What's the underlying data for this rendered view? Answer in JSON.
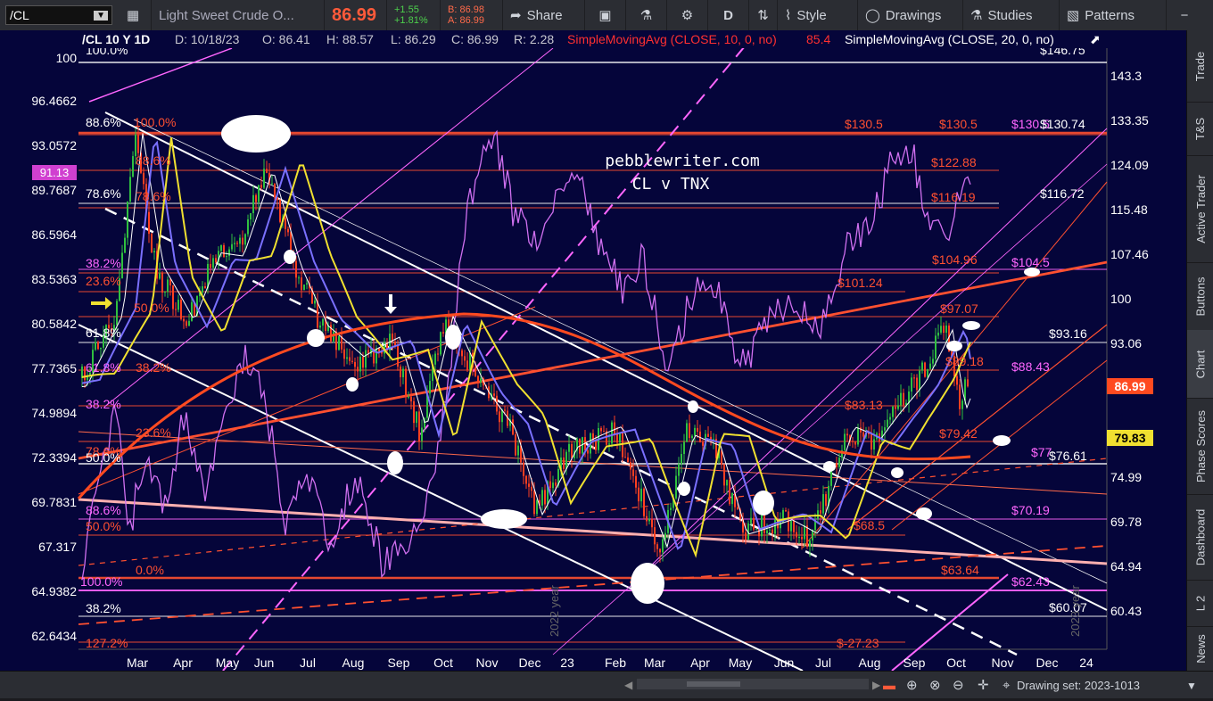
{
  "toolbar": {
    "symbol": "/CL",
    "description": "Light Sweet Crude O...",
    "last": "86.99",
    "change": "+1.55",
    "change_pct": "+1.81%",
    "bid": "B: 86.98",
    "ask": "A: 86.99",
    "share": "Share",
    "period": "D",
    "style": "Style",
    "drawings": "Drawings",
    "studies": "Studies",
    "patterns": "Patterns"
  },
  "header": {
    "title": "/CL 10 Y 1D",
    "date": "D: 10/18/23",
    "open": "O: 86.41",
    "high": "H: 88.57",
    "low": "L: 86.29",
    "close": "C: 86.99",
    "range": "R: 2.28",
    "sma10": "SimpleMovingAvg (CLOSE, 10, 0, no)",
    "sma10_value": "85.4",
    "sma20": "SimpleMovingAvg (CLOSE, 20, 0, no)"
  },
  "watermark": {
    "line1": "pebblewriter.com",
    "line2": "CL v TNX"
  },
  "left_axis": [
    "100",
    "96.4662",
    "93.0572",
    "89.7687",
    "86.5964",
    "83.5363",
    "80.5842",
    "77.7365",
    "74.9894",
    "72.3394",
    "69.7831",
    "67.317",
    "64.9382",
    "62.6434"
  ],
  "right_axis": [
    "143.3",
    "133.35",
    "124.09",
    "115.48",
    "107.46",
    "100",
    "93.06",
    "86.6",
    "80.58",
    "74.99",
    "69.78",
    "64.94",
    "60.43"
  ],
  "price_tags": {
    "last": "86.99",
    "sma": "79.83",
    "tnx": "91.13"
  },
  "x_axis": [
    "Mar",
    "Apr",
    "May",
    "Jun",
    "Jul",
    "Aug",
    "Sep",
    "Oct",
    "Nov",
    "Dec",
    "23",
    "Feb",
    "Mar",
    "Apr",
    "May",
    "Jun",
    "Jul",
    "Aug",
    "Sep",
    "Oct",
    "Nov",
    "Dec",
    "24"
  ],
  "year_markers": [
    "2022 year",
    "2023 year"
  ],
  "fib_labels_left": [
    {
      "text": "100.0%",
      "color": "#ffffff"
    },
    {
      "text": "88.6%",
      "color": "#ffffff"
    },
    {
      "text": "100.0%",
      "color": "#ff5030"
    },
    {
      "text": "88.6%",
      "color": "#ff5030"
    },
    {
      "text": "78.6%",
      "color": "#ffffff"
    },
    {
      "text": "78.6%",
      "color": "#ff5030"
    },
    {
      "text": "38.2%",
      "color": "#ff66ff"
    },
    {
      "text": "23.6%",
      "color": "#ff5030"
    },
    {
      "text": "50.0%",
      "color": "#ff5030"
    },
    {
      "text": "61.8%",
      "color": "#ffffff"
    },
    {
      "text": "61.8%",
      "color": "#ff66ff"
    },
    {
      "text": "38.2%",
      "color": "#ff5030"
    },
    {
      "text": "38.2%",
      "color": "#ff66ff"
    },
    {
      "text": "23.6%",
      "color": "#ff5030"
    },
    {
      "text": "78.6%",
      "color": "#ff5030"
    },
    {
      "text": "50.0%",
      "color": "#ffffff"
    },
    {
      "text": "88.6%",
      "color": "#ff66ff"
    },
    {
      "text": "50.0%",
      "color": "#ff5030"
    },
    {
      "text": "0.0%",
      "color": "#ff5030"
    },
    {
      "text": "100.0%",
      "color": "#ff66ff"
    },
    {
      "text": "38.2%",
      "color": "#ffffff"
    },
    {
      "text": "127.2%",
      "color": "#ff5030"
    }
  ],
  "target_labels": [
    {
      "text": "$146.75",
      "color": "#ffffff"
    },
    {
      "text": "$130.5",
      "color": "#ff5030"
    },
    {
      "text": "$130.5",
      "color": "#ff5030"
    },
    {
      "text": "$130.5",
      "color": "#ff66ff"
    },
    {
      "text": "$130.74",
      "color": "#ffffff"
    },
    {
      "text": "$122.88",
      "color": "#ff5030"
    },
    {
      "text": "$116.19",
      "color": "#ff5030"
    },
    {
      "text": "$116.72",
      "color": "#ffffff"
    },
    {
      "text": "$104.96",
      "color": "#ff5030"
    },
    {
      "text": "$104.5",
      "color": "#ff66ff"
    },
    {
      "text": "$101.24",
      "color": "#ff5030"
    },
    {
      "text": "$97.07",
      "color": "#ff5030"
    },
    {
      "text": "$93.16",
      "color": "#ffffff"
    },
    {
      "text": "$89.18",
      "color": "#ff5030"
    },
    {
      "text": "$88.43",
      "color": "#ff66ff"
    },
    {
      "text": "$83.13",
      "color": "#ff5030"
    },
    {
      "text": "$79.42",
      "color": "#ff5030"
    },
    {
      "text": "$77",
      "color": "#ff66ff"
    },
    {
      "text": "$76.61",
      "color": "#ffffff"
    },
    {
      "text": "$70.19",
      "color": "#ff66ff"
    },
    {
      "text": "$68.5",
      "color": "#ff5030"
    },
    {
      "text": "$63.64",
      "color": "#ff5030"
    },
    {
      "text": "$62.43",
      "color": "#ff66ff"
    },
    {
      "text": "$60.07",
      "color": "#ffffff"
    },
    {
      "text": "$-27.23",
      "color": "#ff5030"
    }
  ],
  "side_tabs": [
    "Trade",
    "T&S",
    "Active Trader",
    "Buttons",
    "Chart",
    "Phase Scores",
    "Dashboard",
    "L 2",
    "News"
  ],
  "bottom": {
    "drawing_set": "Drawing set: 2023-1013"
  },
  "colors": {
    "background": "#05053a",
    "up": "#30c040",
    "down": "#ff4020",
    "tnx": "#d070f0",
    "sma_fast": "#ffffff",
    "sma_mid": "#7a70ff",
    "sma_slow": "#f0e030",
    "sma_long": "#ff4a20"
  }
}
